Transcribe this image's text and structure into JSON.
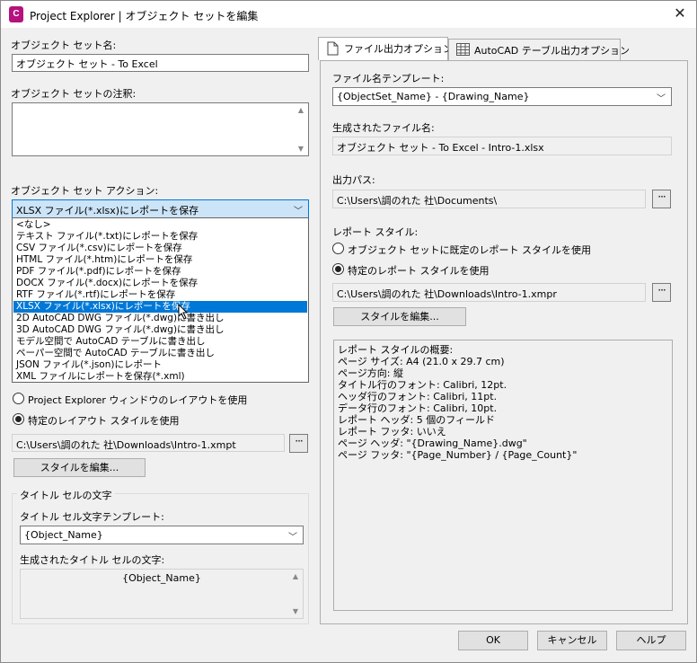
{
  "window": {
    "app_icon_letter": "C",
    "title": "Project Explorer | オブジェクト セットを編集",
    "close_glyph": "✕"
  },
  "left": {
    "name_label": "オブジェクト セット名:",
    "name_value": "オブジェクト セット - To Excel",
    "note_label": "オブジェクト セットの注釈:",
    "note_value": "",
    "action_label": "オブジェクト セット アクション:",
    "action_selected": "XLSX ファイル(*.xlsx)にレポートを保存",
    "action_options": [
      "<なし>",
      "テキスト ファイル(*.txt)にレポートを保存",
      "CSV ファイル(*.csv)にレポートを保存",
      "HTML ファイル(*.htm)にレポートを保存",
      "PDF ファイル(*.pdf)にレポートを保存",
      "DOCX ファイル(*.docx)にレポートを保存",
      "RTF ファイル(*.rtf)にレポートを保存",
      "XLSX ファイル(*.xlsx)にレポートを保存",
      "2D AutoCAD DWG ファイル(*.dwg)に書き出し",
      "3D AutoCAD DWG ファイル(*.dwg)に書き出し",
      "モデル空間で AutoCAD テーブルに書き出し",
      "ペーパー空間で AutoCAD テーブルに書き出し",
      "JSON ファイル(*.json)にレポート",
      "XML ファイルにレポートを保存(*.xml)"
    ],
    "selected_option_index": 7,
    "layout_radio_1": "Project Explorer ウィンドウのレイアウトを使用",
    "layout_radio_2": "特定のレイアウト スタイルを使用",
    "layout_path": "C:\\Users\\調のれた 社\\Downloads\\Intro-1.xmpt",
    "edit_style_button": "スタイルを編集...",
    "title_group_label": "タイトル セルの文字",
    "title_template_label": "タイトル セル文字テンプレート:",
    "title_template_value": "{Object_Name}",
    "generated_title_label": "生成されたタイトル セルの文字:",
    "generated_title_value": "{Object_Name}"
  },
  "tabs": [
    {
      "label": "ファイル出力オプション",
      "icon": "document-icon",
      "active": true
    },
    {
      "label": "AutoCAD テーブル出力オプション",
      "icon": "table-icon",
      "active": false
    }
  ],
  "right": {
    "filename_template_label": "ファイル名テンプレート:",
    "filename_template_value": "{ObjectSet_Name} - {Drawing_Name}",
    "generated_filename_label": "生成されたファイル名:",
    "generated_filename_value": "オブジェクト セット - To Excel - Intro-1.xlsx",
    "output_path_label": "出力パス:",
    "output_path_value": "C:\\Users\\調のれた 社\\Documents\\",
    "report_style_label": "レポート スタイル:",
    "style_radio_1": "オブジェクト セットに既定のレポート スタイルを使用",
    "style_radio_2": "特定のレポート スタイルを使用",
    "style_path": "C:\\Users\\調のれた 社\\Downloads\\Intro-1.xmpr",
    "edit_style_button": "スタイルを編集...",
    "summary_lines": [
      "レポート スタイルの概要:",
      "  ページ サイズ: A4 (21.0 x 29.7 cm)",
      "  ページ方向: 縦",
      "  タイトル行のフォント: Calibri, 12pt.",
      "  ヘッダ行のフォント: Calibri, 11pt.",
      "  データ行のフォント: Calibri, 10pt.",
      "  レポート ヘッダ: 5 個のフィールド",
      "  レポート フッタ: いいえ",
      "  ページ ヘッダ: \"{Drawing_Name}.dwg\"",
      "  ページ フッタ: \"{Page_Number} / {Page_Count}\""
    ]
  },
  "footer": {
    "ok": "OK",
    "cancel": "キャンセル",
    "help": "ヘルプ"
  }
}
